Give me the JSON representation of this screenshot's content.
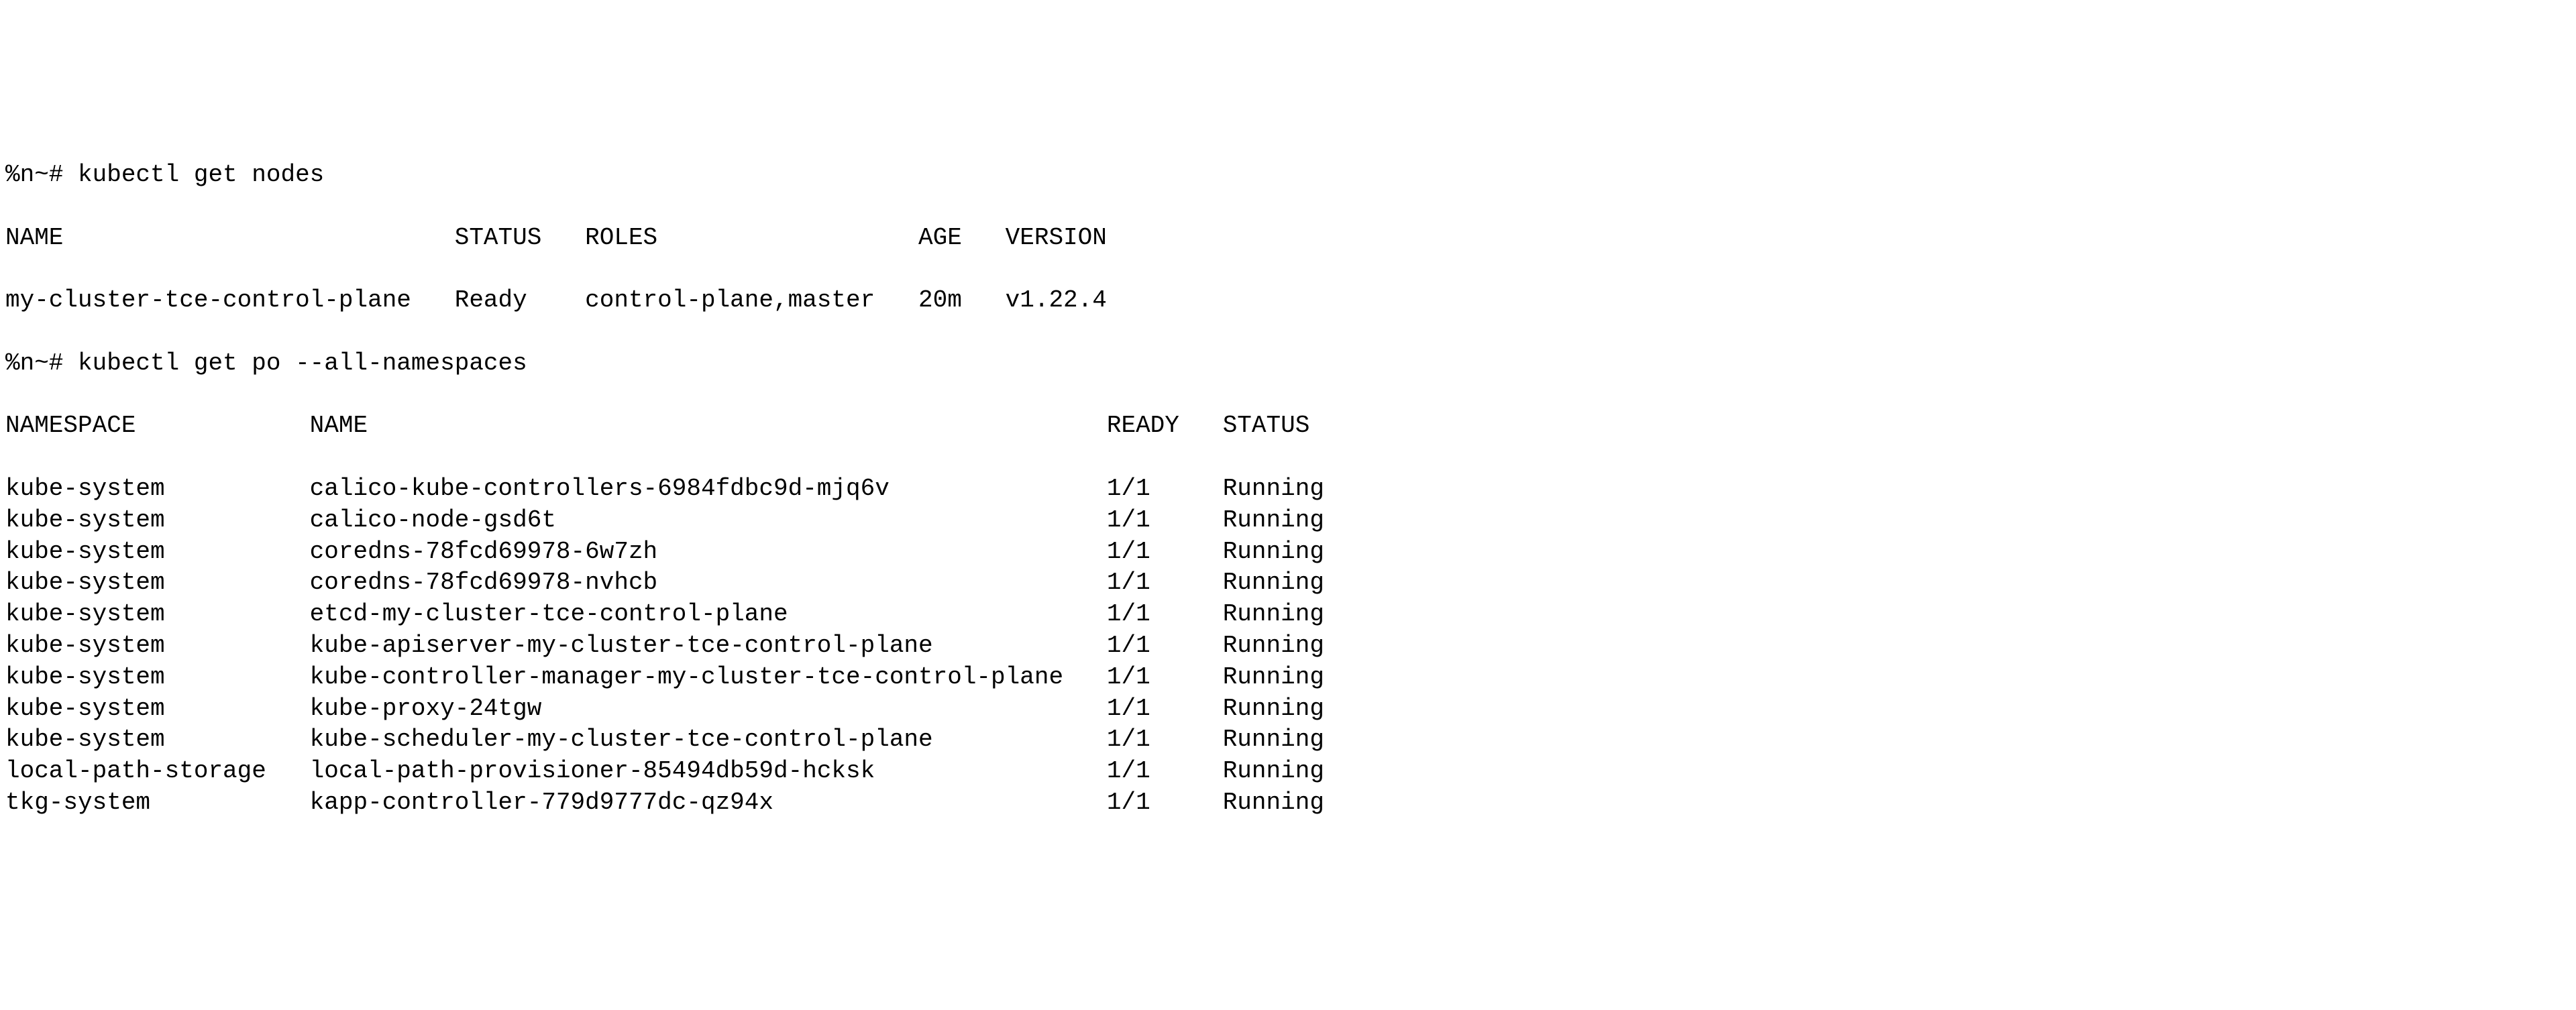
{
  "prompt1": "%n~# kubectl get nodes",
  "nodes_header": {
    "name": "NAME",
    "status": "STATUS",
    "roles": "ROLES",
    "age": "AGE",
    "version": "VERSION"
  },
  "nodes_rows": [
    {
      "name": "my-cluster-tce-control-plane",
      "status": "Ready",
      "roles": "control-plane,master",
      "age": "20m",
      "version": "v1.22.4"
    }
  ],
  "prompt2": "%n~# kubectl get po --all-namespaces",
  "pods_header": {
    "namespace": "NAMESPACE",
    "name": "NAME",
    "ready": "READY",
    "status": "STATUS"
  },
  "pods_rows": [
    {
      "namespace": "kube-system",
      "name": "calico-kube-controllers-6984fdbc9d-mjq6v",
      "ready": "1/1",
      "status": "Running"
    },
    {
      "namespace": "kube-system",
      "name": "calico-node-gsd6t",
      "ready": "1/1",
      "status": "Running"
    },
    {
      "namespace": "kube-system",
      "name": "coredns-78fcd69978-6w7zh",
      "ready": "1/1",
      "status": "Running"
    },
    {
      "namespace": "kube-system",
      "name": "coredns-78fcd69978-nvhcb",
      "ready": "1/1",
      "status": "Running"
    },
    {
      "namespace": "kube-system",
      "name": "etcd-my-cluster-tce-control-plane",
      "ready": "1/1",
      "status": "Running"
    },
    {
      "namespace": "kube-system",
      "name": "kube-apiserver-my-cluster-tce-control-plane",
      "ready": "1/1",
      "status": "Running"
    },
    {
      "namespace": "kube-system",
      "name": "kube-controller-manager-my-cluster-tce-control-plane",
      "ready": "1/1",
      "status": "Running"
    },
    {
      "namespace": "kube-system",
      "name": "kube-proxy-24tgw",
      "ready": "1/1",
      "status": "Running"
    },
    {
      "namespace": "kube-system",
      "name": "kube-scheduler-my-cluster-tce-control-plane",
      "ready": "1/1",
      "status": "Running"
    },
    {
      "namespace": "local-path-storage",
      "name": "local-path-provisioner-85494db59d-hcksk",
      "ready": "1/1",
      "status": "Running"
    },
    {
      "namespace": "tkg-system",
      "name": "kapp-controller-779d9777dc-qz94x",
      "ready": "1/1",
      "status": "Running"
    }
  ],
  "col_widths": {
    "nodes": {
      "name": 31,
      "status": 9,
      "roles": 23,
      "age": 6
    },
    "pods": {
      "namespace": 21,
      "name": 55,
      "ready": 8
    }
  }
}
